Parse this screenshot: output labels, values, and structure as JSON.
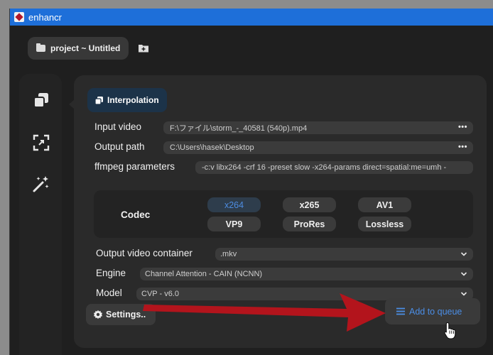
{
  "window": {
    "title": "enhancr"
  },
  "header": {
    "project_label": "project ~ Untitled"
  },
  "sidebar": {
    "items": [
      {
        "icon": "interpolation-icon"
      },
      {
        "icon": "upscale-icon"
      },
      {
        "icon": "magic-wand-icon"
      }
    ]
  },
  "panel": {
    "tab_label": "Interpolation",
    "input_video": {
      "label": "Input video",
      "value": "F:\\ファイル\\storm_-_40581 (540p).mp4",
      "more": "•••"
    },
    "output_path": {
      "label": "Output path",
      "value": "C:\\Users\\hasek\\Desktop",
      "more": "•••"
    },
    "ffmpeg": {
      "label": "ffmpeg parameters",
      "value": "-c:v libx264 -crf 16 -preset slow -x264-params direct=spatial:me=umh -"
    },
    "codec": {
      "label": "Codec",
      "options": [
        "x264",
        "x265",
        "AV1",
        "VP9",
        "ProRes",
        "Lossless"
      ],
      "selected": "x264"
    },
    "container": {
      "label": "Output video container",
      "value": ".mkv"
    },
    "engine": {
      "label": "Engine",
      "value": "Channel Attention - CAIN (NCNN)"
    },
    "model": {
      "label": "Model",
      "value": "CVP - v6.0"
    },
    "settings_button": "Settings..",
    "queue_button": "Add to queue"
  },
  "colors": {
    "titlebar": "#1e6fd9",
    "accent": "#4b8ee6",
    "tab_bg": "#1c3349",
    "annotation_arrow": "#b3141c"
  }
}
